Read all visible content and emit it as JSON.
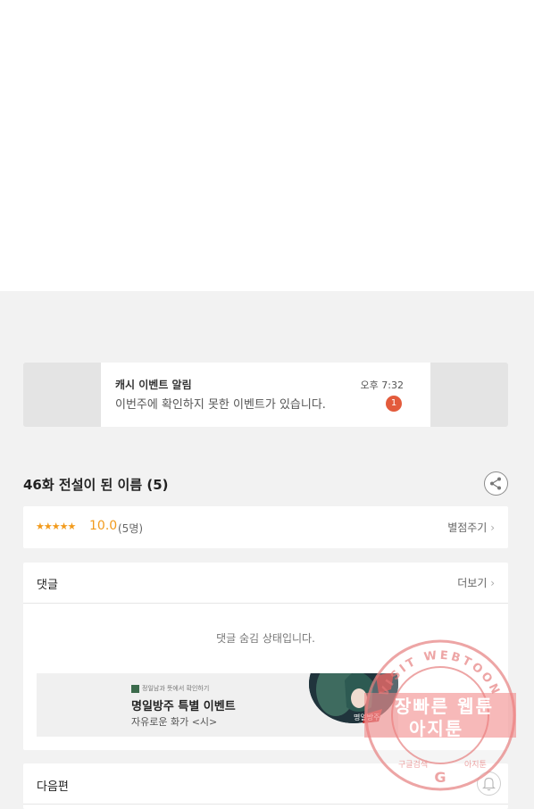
{
  "notification": {
    "title": "캐시 이벤트 알림",
    "time": "오후 7:32",
    "body": "이번주에 확인하지 못한 이벤트가 있습니다.",
    "badge": "1"
  },
  "episode": {
    "title": "46화 전설이 된 이름 (5)"
  },
  "rating": {
    "stars": "★★★★★",
    "score": "10.0",
    "voters": "(5명)",
    "rate_link": "별점주기"
  },
  "comments": {
    "title": "댓글",
    "more": "더보기",
    "hidden_message": "댓글 숨김 상태입니다."
  },
  "ad": {
    "small": "정일남과 뜻에서 확인하기",
    "title": "명일방주 특별 이벤트",
    "subtitle": "자유로운 화가 <시>",
    "logo_text": "명일방주"
  },
  "next_episode": {
    "title": "다음편"
  },
  "watermark": {
    "ring_top": "VISIT WEBTOON",
    "line1": "장빠른 웹툰",
    "line2": "아지툰",
    "ring_bottom_left": "구글검색",
    "ring_bottom_center": "G",
    "ring_bottom_right": "아지툰"
  },
  "colors": {
    "accent_orange": "#f29b1d",
    "badge_red": "#e35b3c",
    "stamp_red": "#e88888"
  }
}
